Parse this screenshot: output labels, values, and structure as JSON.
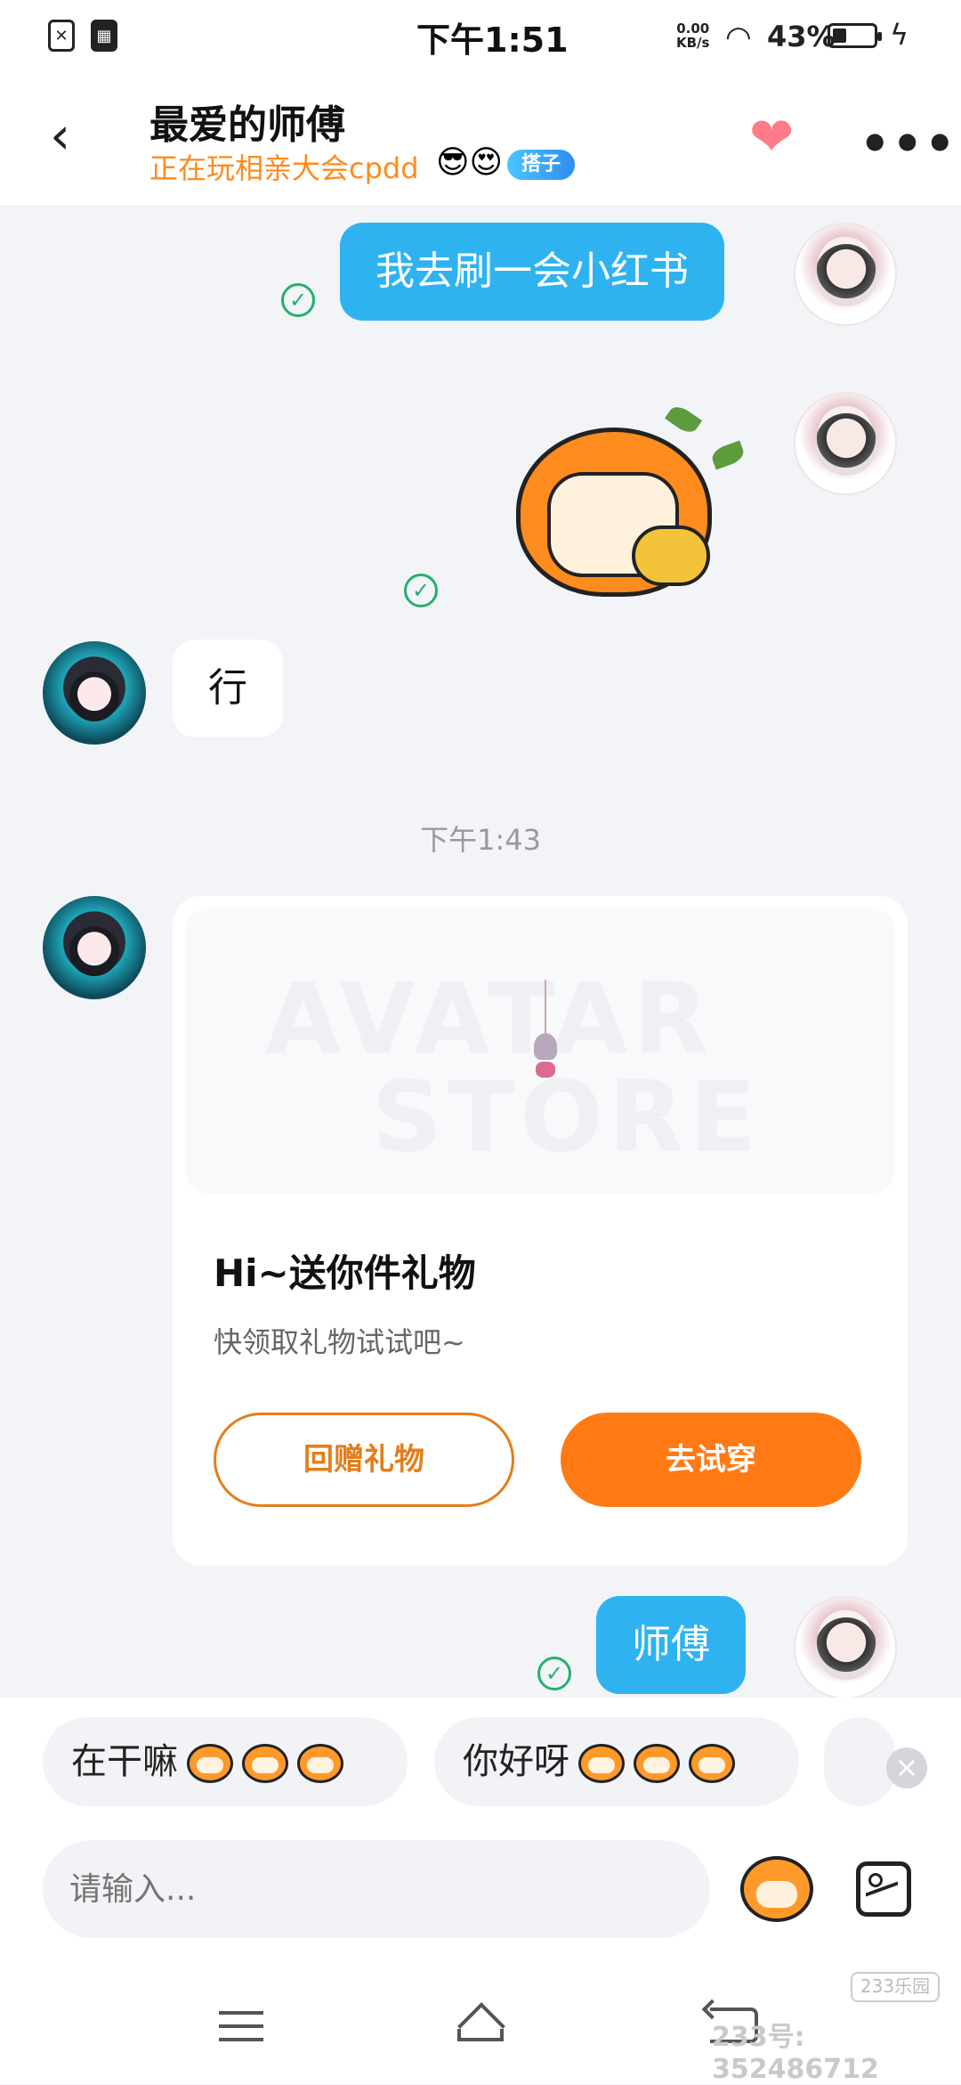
{
  "status_bar": {
    "time": "下午1:51",
    "net_speed": "0.00",
    "net_unit": "KB/s",
    "battery": "43%"
  },
  "header": {
    "title": "最爱的师傅",
    "subtitle": "正在玩相亲大会cpdd",
    "badge": "搭子",
    "accent_color": "#ff8a1d"
  },
  "messages": {
    "m1_text": "我去刷一会小红书",
    "m3_text": "行",
    "timestamp": "下午1:43",
    "m5_text": "师傅"
  },
  "gift_card": {
    "watermark_line1": "AVATAR",
    "watermark_line2": "STORE",
    "title": "Hi~送你件礼物",
    "subtitle": "快领取礼物试试吧~",
    "return_gift_label": "回赠礼物",
    "try_on_label": "去试穿"
  },
  "quick_replies": [
    {
      "text": "在干嘛"
    },
    {
      "text": "你好呀"
    }
  ],
  "input": {
    "placeholder": "请输入..."
  },
  "watermark": {
    "brand": "233乐园",
    "id_text": "233号: 352486712"
  },
  "colors": {
    "bubble_me": "#2eb3f0",
    "read_check": "#23b06b",
    "primary_button": "#ff7a14"
  }
}
